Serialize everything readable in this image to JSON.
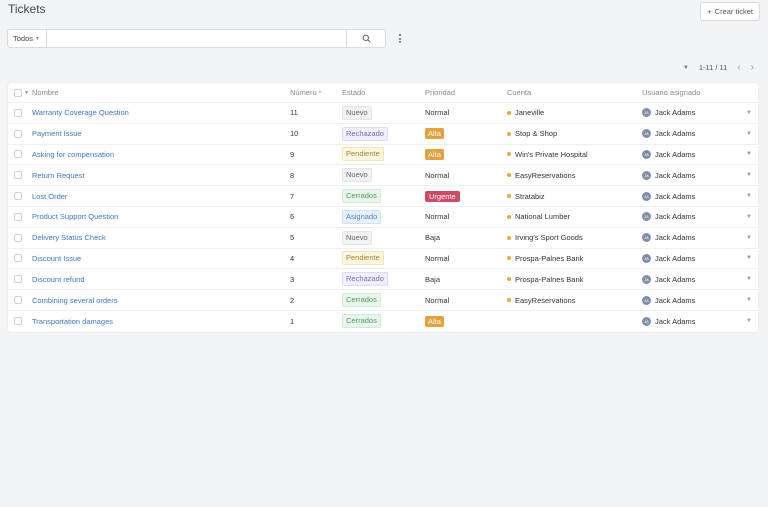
{
  "header": {
    "title": "Tickets",
    "create_label": "Crear ticket"
  },
  "toolbar": {
    "filter_value": "Todos",
    "search_value": "",
    "search_placeholder": ""
  },
  "pager": {
    "range": "1-11 / 11"
  },
  "table": {
    "columns": {
      "name": "Nombre",
      "number": "Número",
      "status": "Estado",
      "priority": "Prioridad",
      "account": "Cuenta",
      "assignee": "Usuario asignado"
    },
    "rows": [
      {
        "name": "Warranty Coverage Question",
        "number": "11",
        "status": "Nuevo",
        "priority": "Normal",
        "account": "Janeville",
        "assignee": "Jack Adams",
        "initials": "JA"
      },
      {
        "name": "Payment Issue",
        "number": "10",
        "status": "Rechazado",
        "priority": "Alta",
        "account": "Stop & Shop",
        "assignee": "Jack Adams",
        "initials": "JA"
      },
      {
        "name": "Asking for compensation",
        "number": "9",
        "status": "Pendiente",
        "priority": "Alta",
        "account": "Win's Private Hospital",
        "assignee": "Jack Adams",
        "initials": "JA"
      },
      {
        "name": "Return Request",
        "number": "8",
        "status": "Nuevo",
        "priority": "Normal",
        "account": "EasyReservations",
        "assignee": "Jack Adams",
        "initials": "JA"
      },
      {
        "name": "Lost Order",
        "number": "7",
        "status": "Cerrados",
        "priority": "Urgente",
        "account": "Stratabiz",
        "assignee": "Jack Adams",
        "initials": "JA"
      },
      {
        "name": "Product Support Question",
        "number": "6",
        "status": "Asignado",
        "priority": "Normal",
        "account": "National Lumber",
        "assignee": "Jack Adams",
        "initials": "JA"
      },
      {
        "name": "Delivery Status Check",
        "number": "5",
        "status": "Nuevo",
        "priority": "Baja",
        "account": "Irving's Sport Goods",
        "assignee": "Jack Adams",
        "initials": "JA"
      },
      {
        "name": "Discount Issue",
        "number": "4",
        "status": "Pendiente",
        "priority": "Normal",
        "account": "Prospa-Palnes Bank",
        "assignee": "Jack Adams",
        "initials": "JA"
      },
      {
        "name": "Discount refund",
        "number": "3",
        "status": "Rechazado",
        "priority": "Baja",
        "account": "Prospa-Palnes Bank",
        "assignee": "Jack Adams",
        "initials": "JA"
      },
      {
        "name": "Combining several orders",
        "number": "2",
        "status": "Cerrados",
        "priority": "Normal",
        "account": "EasyReservations",
        "assignee": "Jack Adams",
        "initials": "JA"
      },
      {
        "name": "Transportation damages",
        "number": "1",
        "status": "Cerrados",
        "priority": "Alta",
        "account": "",
        "assignee": "Jack Adams",
        "initials": "JA"
      }
    ]
  },
  "colors": {
    "link": "#3b78c4",
    "alta": "#e8a13a",
    "urgente": "#d04a64",
    "account_dot": "#e8a83a"
  }
}
